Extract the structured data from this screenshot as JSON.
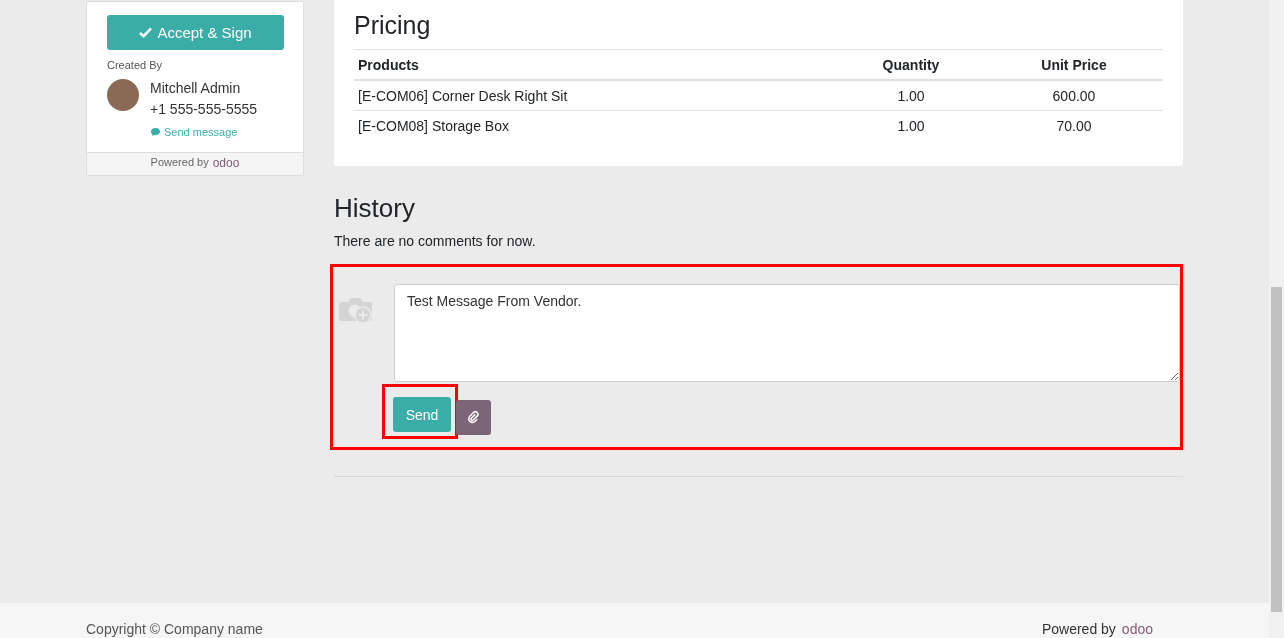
{
  "sidebar": {
    "accept_button": "Accept & Sign",
    "created_by_label": "Created By",
    "author": {
      "name": "Mitchell Admin",
      "phone": "+1 555-555-5555",
      "send_message": "Send message"
    },
    "powered_by": "Powered by",
    "logo": "odoo"
  },
  "pricing": {
    "title": "Pricing",
    "columns": [
      "Products",
      "Quantity",
      "Unit Price"
    ],
    "rows": [
      [
        "[E-COM06] Corner Desk Right Sit",
        "1.00",
        "600.00"
      ],
      [
        "[E-COM08] Storage Box",
        "1.00",
        "70.00"
      ]
    ]
  },
  "history": {
    "title": "History",
    "empty_text": "There are no comments for now.",
    "comment": {
      "value": "Test Message From Vendor.",
      "send_button": "Send"
    }
  },
  "footer": {
    "copyright": "Copyright © Company name",
    "powered_by": "Powered by",
    "logo": "odoo"
  }
}
